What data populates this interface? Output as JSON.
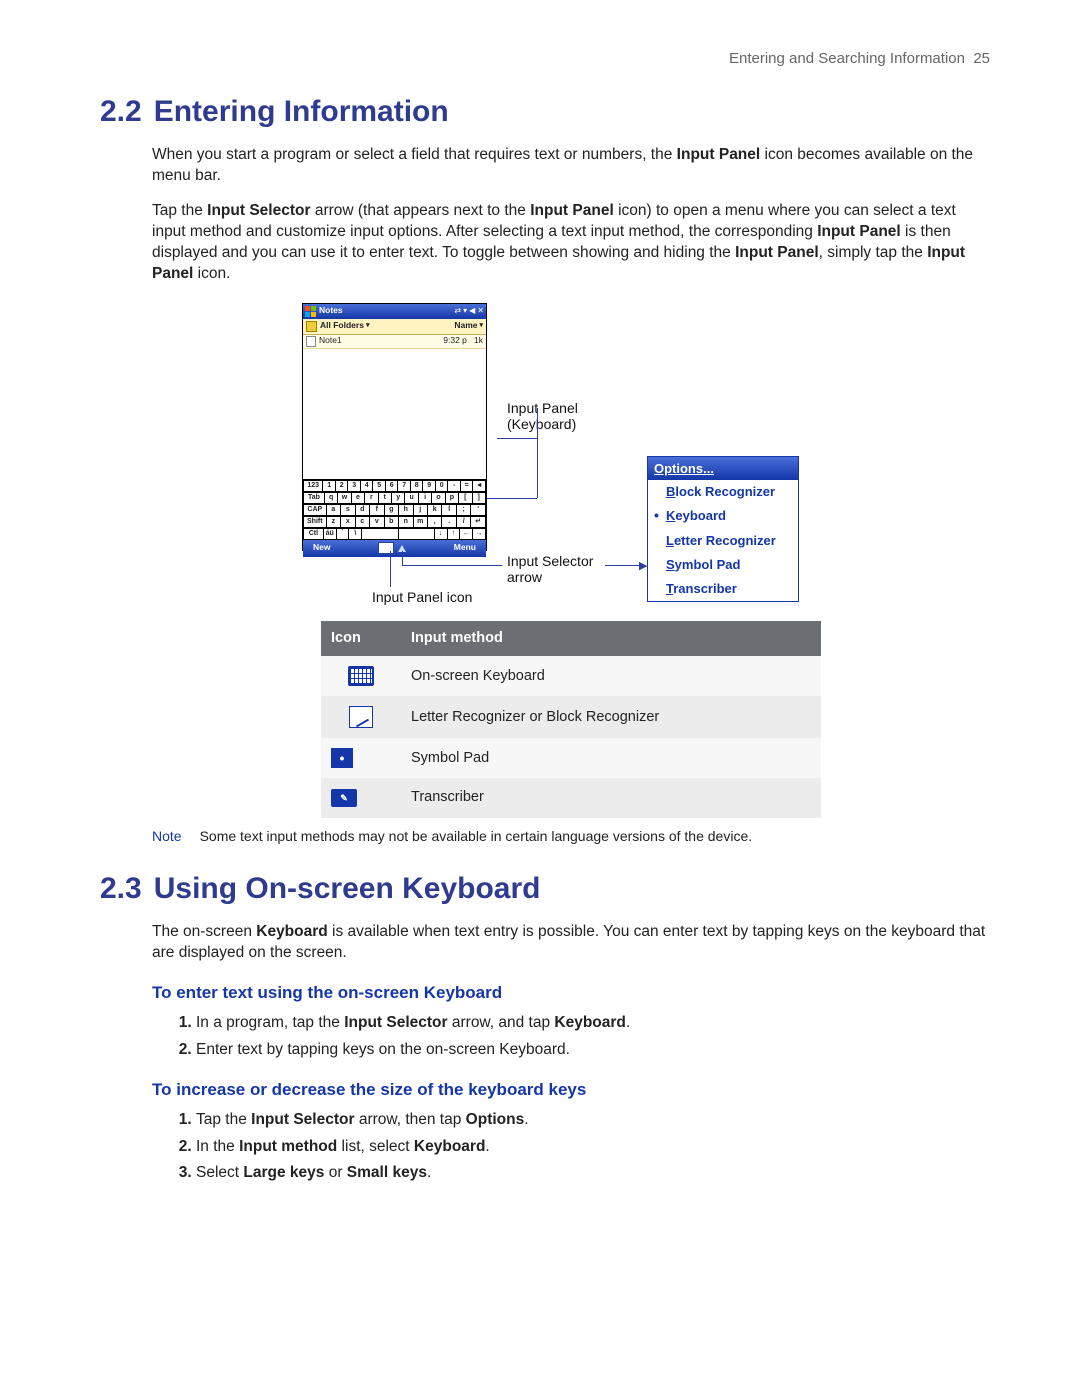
{
  "running_head": {
    "chapter": "Entering and Searching Information",
    "page": "25"
  },
  "sections": {
    "s22": {
      "number": "2.2",
      "title": "Entering Information",
      "paras": [
        {
          "pre": "When you start a program or select a field that requires text or numbers, the ",
          "b1": "Input Panel",
          "post": " icon becomes available on the menu bar."
        },
        {
          "pre": "Tap the ",
          "b1": "Input Selector",
          "mid1": " arrow (that appears next to the ",
          "b2": "Input Panel",
          "mid2": " icon) to open a menu where you can select a text input method and customize input options. After selecting a text input method, the corresponding ",
          "b3": "Input Panel",
          "mid3": " is then displayed and you can use it to enter text. To toggle between showing and hiding the ",
          "b4": "Input Panel",
          "mid4": ", simply tap the ",
          "b5": "Input Panel",
          "post": " icon."
        }
      ]
    },
    "s23": {
      "number": "2.3",
      "title": "Using On-screen Keyboard",
      "intro": {
        "pre": "The on-screen ",
        "b1": "Keyboard",
        "post": " is available when text entry is possible. You can enter text by tapping keys on the keyboard that are displayed on the screen."
      },
      "sub1": {
        "title": "To enter text using the on-screen Keyboard",
        "steps": [
          {
            "pre": "In a program, tap the ",
            "b1": "Input Selector",
            "mid": " arrow, and tap ",
            "b2": "Keyboard",
            "post": "."
          },
          {
            "text": "Enter text by tapping keys on the on-screen Keyboard."
          }
        ]
      },
      "sub2": {
        "title": "To increase or decrease the size of the keyboard keys",
        "steps": [
          {
            "pre": "Tap the ",
            "b1": "Input Selector",
            "mid": " arrow, then tap ",
            "b2": "Options",
            "post": "."
          },
          {
            "pre": "In the ",
            "b1": "Input method",
            "mid": " list, select ",
            "b2": "Keyboard",
            "post": "."
          },
          {
            "pre": "Select ",
            "b1": "Large keys",
            "mid": " or ",
            "b2": "Small keys",
            "post": "."
          }
        ]
      }
    }
  },
  "diagram": {
    "phone": {
      "title": "Notes",
      "sys": [
        "⇄",
        "▾",
        "◀",
        "✕"
      ],
      "folders_label": "All Folders",
      "name_label": "Name",
      "note_row": {
        "name": "Note1",
        "time": "9:32 p",
        "size": "1k"
      },
      "kb_rows": [
        [
          "123",
          "1",
          "2",
          "3",
          "4",
          "5",
          "6",
          "7",
          "8",
          "9",
          "0",
          "-",
          "=",
          "◄"
        ],
        [
          "Tab",
          "q",
          "w",
          "e",
          "r",
          "t",
          "y",
          "u",
          "i",
          "o",
          "p",
          "[",
          "]"
        ],
        [
          "CAP",
          "a",
          "s",
          "d",
          "f",
          "g",
          "h",
          "j",
          "k",
          "l",
          ";",
          "'"
        ],
        [
          "Shift",
          "z",
          "x",
          "c",
          "v",
          "b",
          "n",
          "m",
          ",",
          ".",
          "/",
          "↵"
        ],
        [
          "Ctl",
          "áü",
          "`",
          "\\",
          " ",
          " ",
          "↓",
          "↑",
          "←",
          "→"
        ]
      ],
      "menu_left": "New",
      "menu_right": "Menu"
    },
    "labels": {
      "panel": "Input Panel\n(Keyboard)",
      "selector": "Input Selector\narrow",
      "icon": "Input Panel icon"
    },
    "popup": {
      "options": "Options...",
      "items": [
        {
          "u": "B",
          "rest": "lock Recognizer",
          "selected": false
        },
        {
          "u": "K",
          "rest": "eyboard",
          "selected": true
        },
        {
          "u": "L",
          "rest": "etter Recognizer",
          "selected": false
        },
        {
          "u": "S",
          "rest": "ymbol Pad",
          "selected": false
        },
        {
          "u": "T",
          "rest": "ranscriber",
          "selected": false
        }
      ]
    }
  },
  "im_table": {
    "headers": {
      "icon": "Icon",
      "method": "Input method"
    },
    "rows": [
      {
        "method": "On-screen Keyboard",
        "icon": "keyboard"
      },
      {
        "method": "Letter Recognizer or Block Recognizer",
        "icon": "pen"
      },
      {
        "method": "Symbol Pad",
        "icon": "sym"
      },
      {
        "method": "Transcriber",
        "icon": "trans"
      }
    ]
  },
  "note": {
    "label": "Note",
    "text": "Some text input methods may not be available in certain language versions of the device."
  }
}
